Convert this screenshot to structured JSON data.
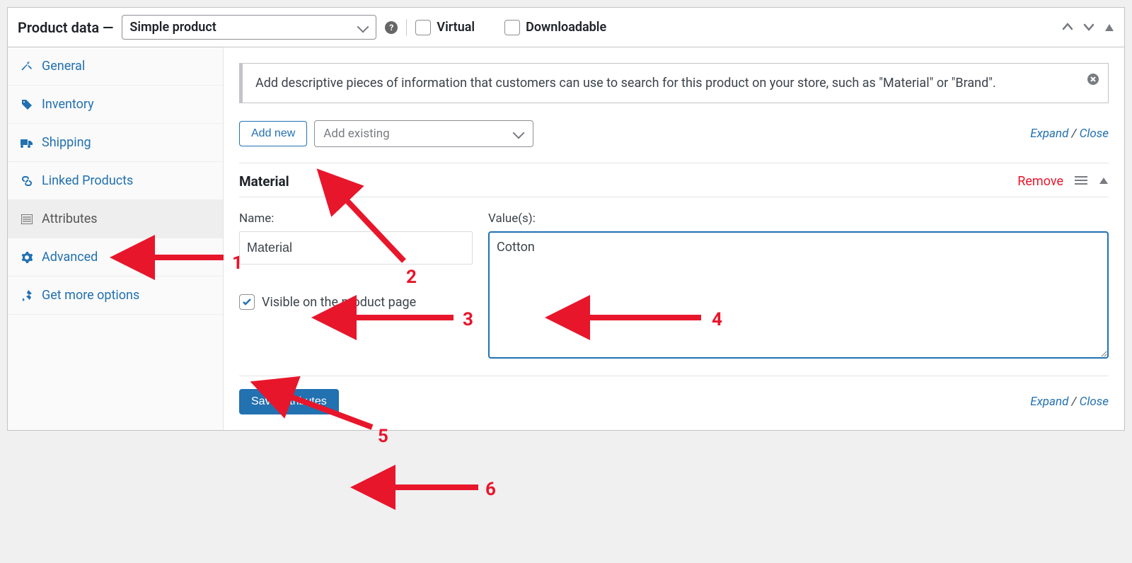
{
  "header": {
    "title": "Product data —",
    "product_type": "Simple product",
    "virtual_label": "Virtual",
    "downloadable_label": "Downloadable"
  },
  "sidebar": {
    "items": [
      {
        "id": "general",
        "label": "General",
        "icon": "wrench"
      },
      {
        "id": "inventory",
        "label": "Inventory",
        "icon": "tag"
      },
      {
        "id": "shipping",
        "label": "Shipping",
        "icon": "truck"
      },
      {
        "id": "linked",
        "label": "Linked Products",
        "icon": "link"
      },
      {
        "id": "attributes",
        "label": "Attributes",
        "icon": "list",
        "active": true
      },
      {
        "id": "advanced",
        "label": "Advanced",
        "icon": "gear"
      },
      {
        "id": "more",
        "label": "Get more options",
        "icon": "plug"
      }
    ]
  },
  "notice": {
    "text": "Add descriptive pieces of information that customers can use to search for this product on your store, such as \"Material\" or \"Brand\"."
  },
  "toolbar": {
    "add_new": "Add new",
    "add_existing_placeholder": "Add existing",
    "expand": "Expand",
    "close": "Close"
  },
  "attribute": {
    "title": "Material",
    "remove": "Remove",
    "name_label": "Name:",
    "name_value": "Material",
    "values_label": "Value(s):",
    "values_value": "Cotton",
    "visible_label": "Visible on the product page"
  },
  "save": {
    "label": "Save attributes"
  },
  "annotations": {
    "n1": "1",
    "n2": "2",
    "n3": "3",
    "n4": "4",
    "n5": "5",
    "n6": "6"
  }
}
